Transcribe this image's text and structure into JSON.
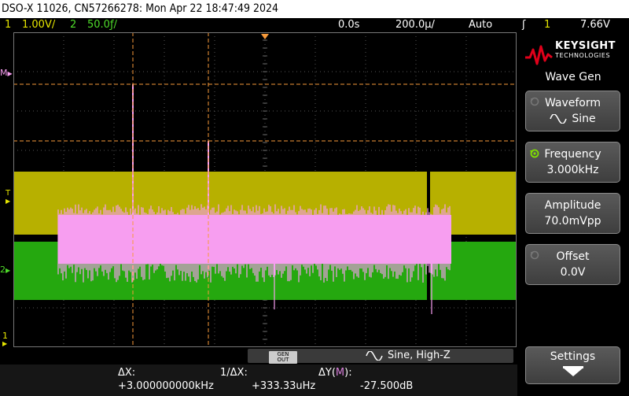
{
  "title": "DSO-X 11026, CN57266278: Mon Apr 22 18:47:49 2024",
  "status": {
    "ch1_num": "1",
    "ch1_scale": "1.00V/",
    "ch2_num": "2",
    "ch2_scale": "50.0ƒ/",
    "delay": "0.0s",
    "timebase": "200.0µ/",
    "mode": "Auto",
    "trigger_icon": "ʃ",
    "trigger_source": "1",
    "trigger_level": "7.66V"
  },
  "markers": {
    "math": "M",
    "trigger": "T",
    "ch2": "2",
    "ch1": "1"
  },
  "colors": {
    "ch1": "#b7b000",
    "ch1_label": "#e6e600",
    "ch2": "#25a80f",
    "ch2_label": "#4fdc2a",
    "math": "#f79ef0",
    "cursor": "#f79a3a",
    "accent_red": "#e0001a"
  },
  "brand": {
    "name": "KEYSIGHT",
    "sub": "TECHNOLOGIES"
  },
  "menu": {
    "title": "Wave Gen",
    "waveform_label": "Waveform",
    "waveform_value": "Sine",
    "frequency_label": "Frequency",
    "frequency_value": "3.000kHz",
    "amplitude_label": "Amplitude",
    "amplitude_value": "70.0mVpp",
    "offset_label": "Offset",
    "offset_value": "0.0V",
    "settings_label": "Settings"
  },
  "gen": {
    "out_label_top": "GEN",
    "out_label_bottom": "OUT",
    "description": "Sine, High-Z"
  },
  "measurements": {
    "dx_label": "ΔX:",
    "dx_value": "+3.000000000kHz",
    "inv_dx_label": "1/ΔX:",
    "inv_dx_value": "+333.33uHz",
    "dy_label_prefix": "ΔY(",
    "dy_label_m": "M",
    "dy_label_suffix": "):",
    "dy_value": "-27.500dB"
  },
  "icons": {
    "waveform": "sine-wave-icon",
    "frequency": "rotate-arrow-icon",
    "settings": "down-arrow-icon",
    "brand": "keysight-wave-logo-icon"
  }
}
